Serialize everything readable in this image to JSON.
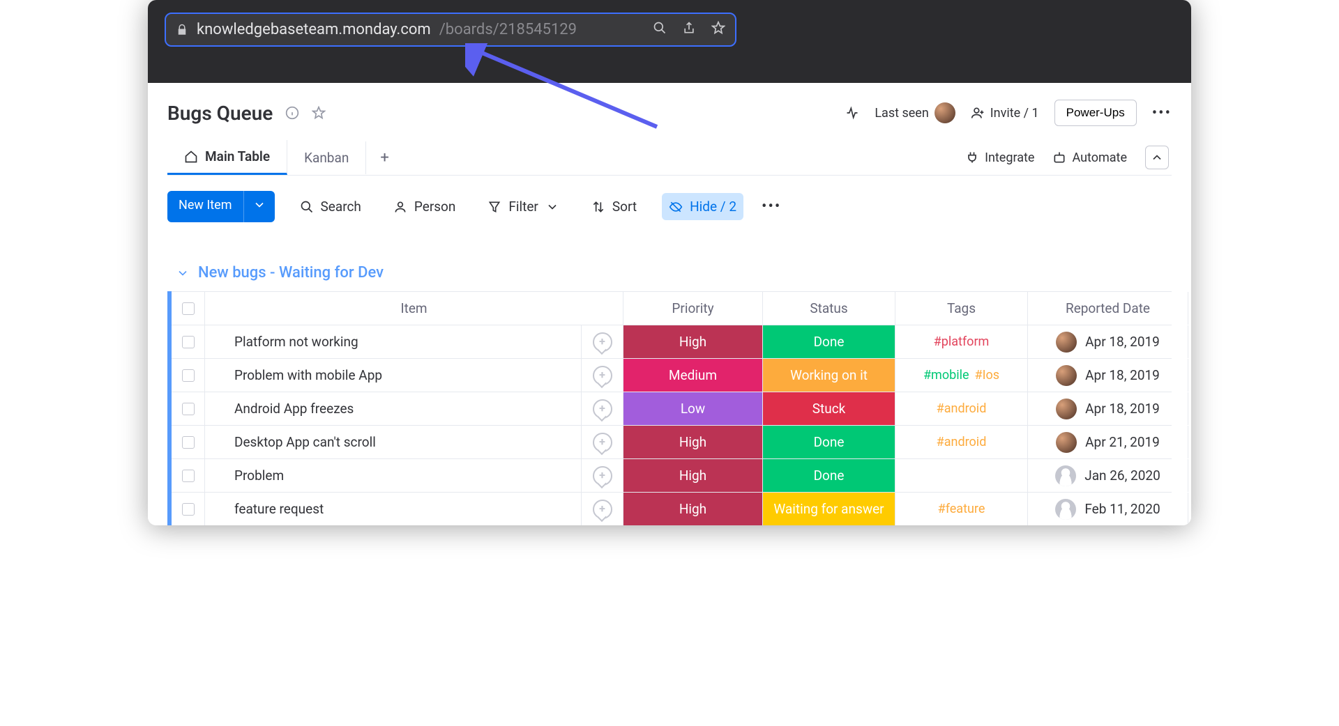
{
  "browser": {
    "url_host": "knowledgebaseteam.monday.com",
    "url_path": "/boards/218545129"
  },
  "header": {
    "title": "Bugs Queue",
    "last_seen": "Last seen",
    "invite": "Invite / 1",
    "powerups": "Power-Ups"
  },
  "tabs": {
    "main": "Main Table",
    "kanban": "Kanban",
    "integrate": "Integrate",
    "automate": "Automate"
  },
  "toolbar": {
    "new_item": "New Item",
    "search": "Search",
    "person": "Person",
    "filter": "Filter",
    "sort": "Sort",
    "hide": "Hide / 2"
  },
  "group": {
    "title": "New bugs - Waiting for Dev",
    "columns": {
      "item": "Item",
      "priority": "Priority",
      "status": "Status",
      "tags": "Tags",
      "reported": "Reported Date"
    },
    "rows": [
      {
        "item": "Platform not working",
        "priority": {
          "label": "High",
          "bg": "#bb3354"
        },
        "status": {
          "label": "Done",
          "bg": "#00c875"
        },
        "tags": [
          {
            "text": "#platform",
            "color": "#e2445c"
          }
        ],
        "avatar": "photo",
        "date": "Apr 18, 2019"
      },
      {
        "item": "Problem with mobile App",
        "priority": {
          "label": "Medium",
          "bg": "#e2236b"
        },
        "status": {
          "label": "Working on it",
          "bg": "#fdab3d"
        },
        "tags": [
          {
            "text": "#mobile",
            "color": "#00c875"
          },
          {
            "text": "#Ios",
            "color": "#fdab3d"
          }
        ],
        "avatar": "photo",
        "date": "Apr 18, 2019"
      },
      {
        "item": "Android App freezes",
        "priority": {
          "label": "Low",
          "bg": "#a25ddc"
        },
        "status": {
          "label": "Stuck",
          "bg": "#df2f4a"
        },
        "tags": [
          {
            "text": "#android",
            "color": "#fdab3d"
          }
        ],
        "avatar": "photo",
        "date": "Apr 18, 2019"
      },
      {
        "item": "Desktop App can't scroll",
        "priority": {
          "label": "High",
          "bg": "#bb3354"
        },
        "status": {
          "label": "Done",
          "bg": "#00c875"
        },
        "tags": [
          {
            "text": "#android",
            "color": "#fdab3d"
          }
        ],
        "avatar": "photo",
        "date": "Apr 21, 2019"
      },
      {
        "item": "Problem",
        "priority": {
          "label": "High",
          "bg": "#bb3354"
        },
        "status": {
          "label": "Done",
          "bg": "#00c875"
        },
        "tags": [],
        "avatar": "grey",
        "date": "Jan 26, 2020"
      },
      {
        "item": "feature request",
        "priority": {
          "label": "High",
          "bg": "#bb3354"
        },
        "status": {
          "label": "Waiting for answer",
          "bg": "#ffcb00"
        },
        "tags": [
          {
            "text": "#feature",
            "color": "#fdab3d"
          }
        ],
        "avatar": "grey",
        "date": "Feb 11, 2020"
      }
    ]
  }
}
